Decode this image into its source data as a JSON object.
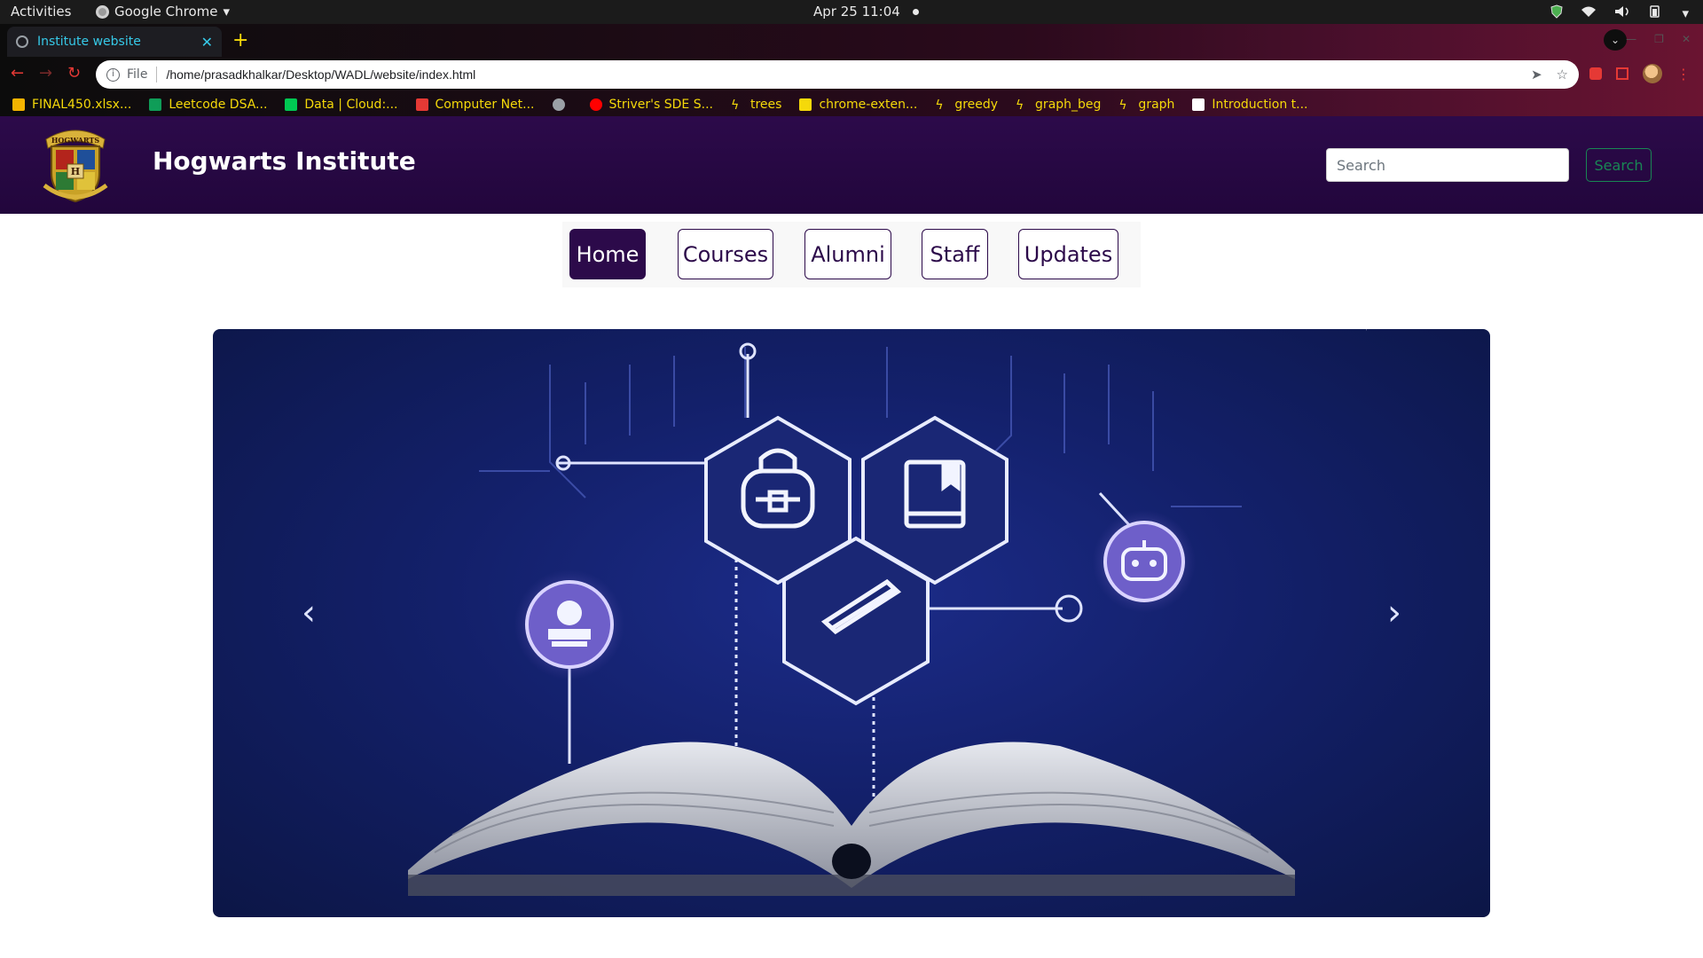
{
  "os_bar": {
    "activities": "Activities",
    "app_name": "Google Chrome",
    "clock": "Apr 25  11:04"
  },
  "browser": {
    "tab_title": "Institute website",
    "scheme": "File",
    "url": "/home/prasadkhalkar/Desktop/WADL/website/index.html",
    "bookmarks": [
      {
        "label": "FINAL450.xlsx...",
        "icon": "drive-icon"
      },
      {
        "label": "Leetcode DSA...",
        "icon": "sheets-icon"
      },
      {
        "label": "Data | Cloud:...",
        "icon": "leaf-icon"
      },
      {
        "label": "Computer Net...",
        "icon": "v-icon"
      },
      {
        "label": "",
        "icon": "globe-icon"
      },
      {
        "label": "Striver's SDE S...",
        "icon": "youtube-icon"
      },
      {
        "label": "trees",
        "icon": "bolt-icon"
      },
      {
        "label": "chrome-exten...",
        "icon": "lg-icon"
      },
      {
        "label": "greedy",
        "icon": "bolt-icon"
      },
      {
        "label": "graph_beg",
        "icon": "bolt-icon"
      },
      {
        "label": "graph",
        "icon": "bolt-icon"
      },
      {
        "label": "Introduction t...",
        "icon": "dev-icon"
      }
    ]
  },
  "site": {
    "title": "Hogwarts Institute",
    "crest_text": "HOGWARTS",
    "search": {
      "placeholder": "Search",
      "button": "Search"
    },
    "nav": [
      {
        "label": "Home",
        "active": true
      },
      {
        "label": "Courses",
        "active": false
      },
      {
        "label": "Alumni",
        "active": false
      },
      {
        "label": "Staff",
        "active": false
      },
      {
        "label": "Updates",
        "active": false
      }
    ],
    "carousel": {
      "prev": "‹",
      "next": "›",
      "image": "digital-education-book-illustration"
    }
  },
  "colors": {
    "brand_purple": "#2c0a4a",
    "search_green": "#198754",
    "tab_accent": "#36c9e8",
    "bookmark_text": "#f5d90a"
  }
}
